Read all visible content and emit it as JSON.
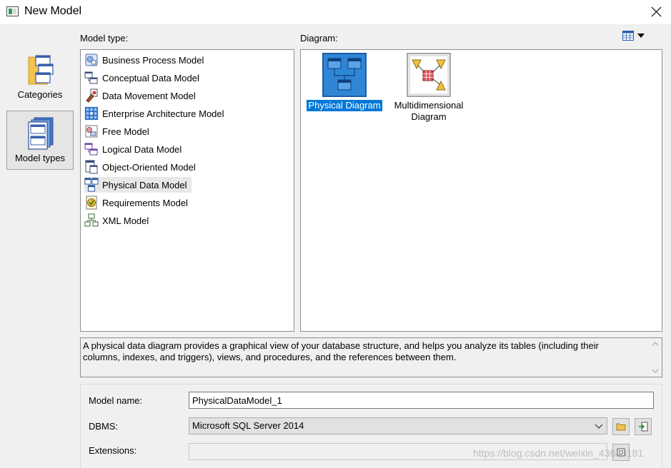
{
  "window": {
    "title": "New Model"
  },
  "categories": [
    {
      "label": "Categories",
      "icon": "folder-windows-icon"
    },
    {
      "label": "Model types",
      "icon": "windows-stack-icon",
      "selected": true
    }
  ],
  "model_type": {
    "label": "Model type:",
    "items": [
      {
        "label": "Business Process Model",
        "icon": "business-process-model-icon"
      },
      {
        "label": "Conceptual Data Model",
        "icon": "conceptual-data-model-icon"
      },
      {
        "label": "Data Movement Model",
        "icon": "data-movement-model-icon"
      },
      {
        "label": "Enterprise Architecture Model",
        "icon": "enterprise-architecture-model-icon"
      },
      {
        "label": "Free Model",
        "icon": "free-model-icon"
      },
      {
        "label": "Logical Data Model",
        "icon": "logical-data-model-icon"
      },
      {
        "label": "Object-Oriented Model",
        "icon": "object-oriented-model-icon"
      },
      {
        "label": "Physical Data Model",
        "icon": "physical-data-model-icon",
        "selected": true
      },
      {
        "label": "Requirements Model",
        "icon": "requirements-model-icon"
      },
      {
        "label": "XML Model",
        "icon": "xml-model-icon"
      }
    ]
  },
  "diagram": {
    "label": "Diagram:",
    "items": [
      {
        "label": "Physical Diagram",
        "icon": "physical-diagram-icon",
        "selected": true
      },
      {
        "label_line1": "Multidimensional",
        "label_line2": "Diagram",
        "icon": "multidimensional-diagram-icon"
      }
    ]
  },
  "description": {
    "line1": "A physical data diagram provides a graphical view of your database structure, and helps you analyze its tables (including their",
    "line2": "columns, indexes, and triggers), views, and procedures, and the references between them."
  },
  "form": {
    "model_name_label": "Model name:",
    "model_name_value": "PhysicalDataModel_1",
    "dbms_label": "DBMS:",
    "dbms_value": "Microsoft SQL Server 2014",
    "extensions_label": "Extensions:",
    "extensions_value": ""
  },
  "watermark": "https://blog.csdn.net/weixin_43640181",
  "colors": {
    "selection": "#0078d7",
    "background": "#f0f0f0",
    "panel": "#ffffff"
  }
}
